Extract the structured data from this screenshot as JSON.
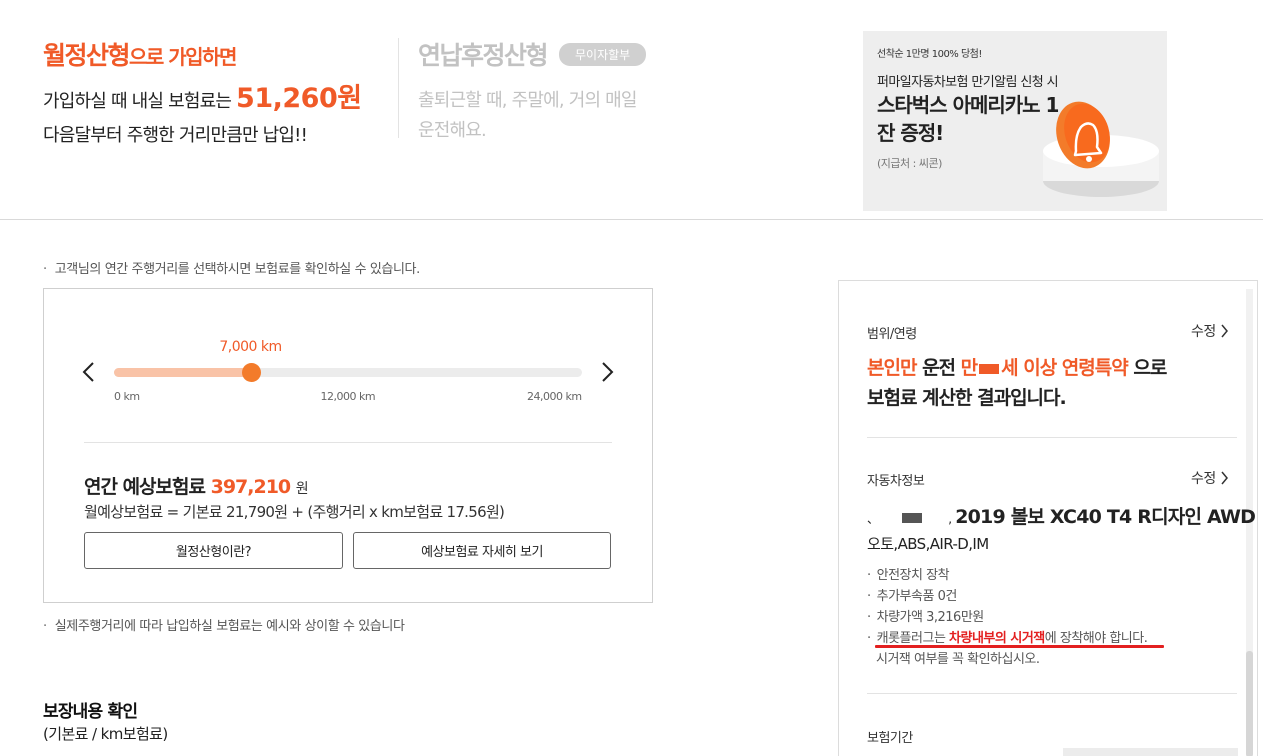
{
  "promo": {
    "monthly": {
      "title": "월정산형",
      "title_suffix": "으로 가입하면",
      "line1_prefix": "가입하실 때 내실 보험료는",
      "line1_amount": "51,260원",
      "line2": "다음달부터 주행한 거리만큼만 납입!!"
    },
    "annual": {
      "title": "연납후정산형",
      "badge": "무이자할부",
      "desc_line1": "출퇴근할 때, 주말에, 거의 매일",
      "desc_line2": "운전해요."
    },
    "banner": {
      "tagline": "선착순 1만명 100% 당첨!",
      "headline": "퍼마일자동차보험 만기알림 신청 시",
      "prize": "스타벅스 아메리카노 1잔 증정!",
      "note": "(지급처 : 씨콘)",
      "icon": "bell-icon",
      "accent": "#f37b2a"
    }
  },
  "mileage": {
    "intro_note": "고객님의 연간 주행거리를 선택하시면 보험료를 확인하실 수 있습니다.",
    "selected_label": "7,000 km",
    "selected_km": 7000,
    "max_km": 24000,
    "ticks": [
      {
        "label": "0 km",
        "km": 0
      },
      {
        "label": "12,000 km",
        "km": 12000
      },
      {
        "label": "24,000 km",
        "km": 24000
      }
    ],
    "prev_icon": "chevron-left-icon",
    "next_icon": "chevron-right-icon",
    "premium_label": "연간 예상보험료",
    "premium_amount": "397,210",
    "premium_unit": "원",
    "formula": "월예상보험료 = 기본료 21,790원 + (주행거리 x km보험료 17.56원)",
    "btn_what": "월정산형이란?",
    "btn_detail": "예상보험료 자세히 보기",
    "bottom_note": "실제주행거리에 따라 납입하실 보험료는 예시와 상이할 수 있습니다"
  },
  "coverage": {
    "title": "보장내용 확인",
    "subtitle": "(기본료 / km보험료)"
  },
  "summary": {
    "scope_label": "범위/연령",
    "edit_label": "수정",
    "headline_hl1": "본인만",
    "headline_mid": " 운전 ",
    "headline_hl2a": "만",
    "headline_hl2b": "세 이상 연령특약",
    "headline_tail": " 으로",
    "headline_line2": "보험료 계산한 결과입니다.",
    "vehicle_label": "자동차정보",
    "vehicle_prefix": "、",
    "vehicle_sep": ",",
    "vehicle_name": "2019 볼보 XC40 T4 R디자인 AWD",
    "vehicle_options": "오토,ABS,AIR-D,IM",
    "bullets": [
      "안전장치 장착",
      "추가부속품 0건",
      "차량가액 3,216만원"
    ],
    "warning_prefix": "캐롯플러그는 ",
    "warning_strong": "차량내부의 시거잭",
    "warning_suffix": "에 장착해야 합니다.",
    "warning_line2": "시거잭 여부를 꼭 확인하십시오.",
    "period_label": "보험기간",
    "accent_color": "#f05a28",
    "warning_color": "#e32020"
  }
}
